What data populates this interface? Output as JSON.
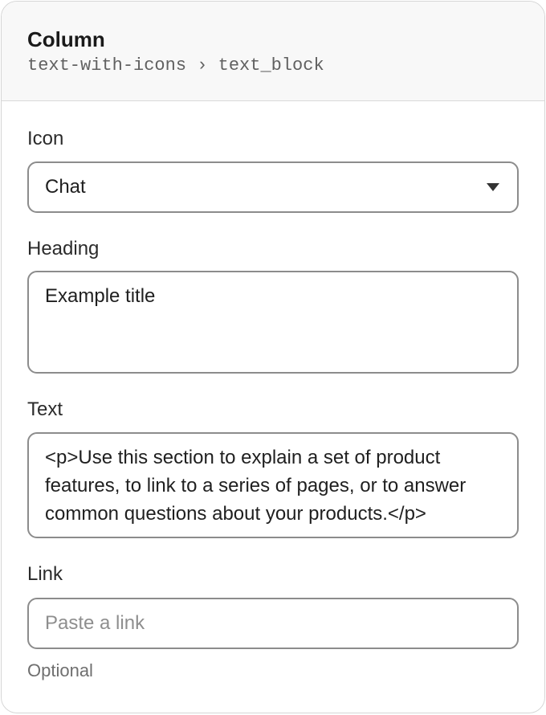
{
  "header": {
    "title": "Column",
    "breadcrumb": "text-with-icons › text_block"
  },
  "fields": {
    "icon": {
      "label": "Icon",
      "value": "Chat"
    },
    "heading": {
      "label": "Heading",
      "value": "Example title"
    },
    "text": {
      "label": "Text",
      "value": "<p>Use this section to explain a set of product features, to link to a series of pages, or to answer common questions about your products.</p>"
    },
    "link": {
      "label": "Link",
      "placeholder": "Paste a link",
      "hint": "Optional"
    }
  },
  "icons": {
    "dropdown": "chevron-down-icon"
  },
  "colors": {
    "border": "#8c8c8c",
    "header_bg": "#f8f8f8",
    "text": "#202020",
    "muted": "#6f6f6f"
  }
}
